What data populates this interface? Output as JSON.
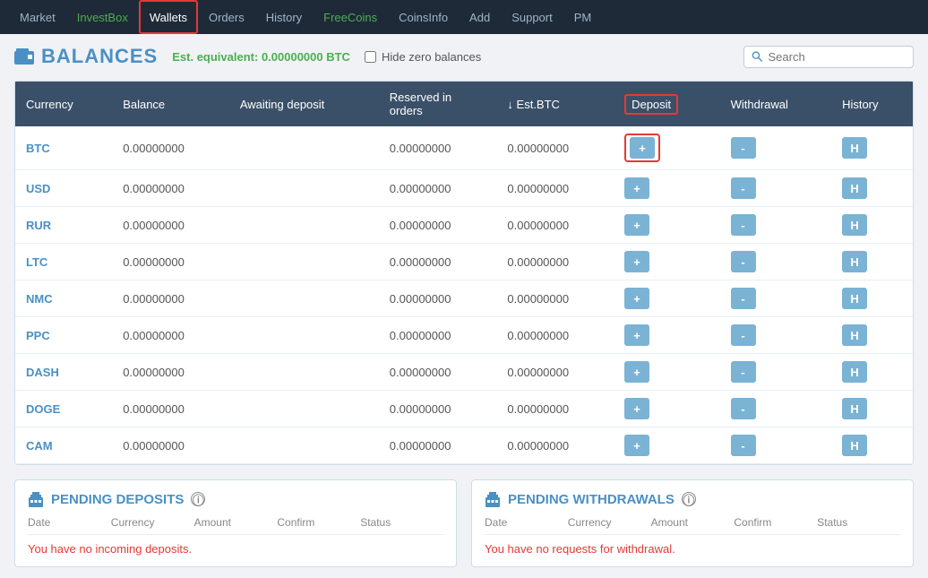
{
  "nav": {
    "items": [
      {
        "label": "Market",
        "href": "#",
        "class": ""
      },
      {
        "label": "InvestBox",
        "href": "#",
        "class": "green-nav"
      },
      {
        "label": "Wallets",
        "href": "#",
        "class": "wallets-nav"
      },
      {
        "label": "Orders",
        "href": "#",
        "class": ""
      },
      {
        "label": "History",
        "href": "#",
        "class": ""
      },
      {
        "label": "FreeCoins",
        "href": "#",
        "class": "green-nav"
      },
      {
        "label": "CoinsInfo",
        "href": "#",
        "class": ""
      },
      {
        "label": "Add",
        "href": "#",
        "class": ""
      },
      {
        "label": "Support",
        "href": "#",
        "class": ""
      },
      {
        "label": "PM",
        "href": "#",
        "class": ""
      }
    ]
  },
  "balances": {
    "title": "BALANCES",
    "est_label": "Est. equivalent:",
    "est_value": "0.00000000 BTC",
    "hide_zero_label": "Hide zero balances",
    "search_placeholder": "Search"
  },
  "table": {
    "headers": [
      {
        "label": "Currency",
        "key": "currency"
      },
      {
        "label": "Balance",
        "key": "balance"
      },
      {
        "label": "Awaiting deposit",
        "key": "awaiting"
      },
      {
        "label": "↓ Reserved in orders",
        "key": "reserved"
      },
      {
        "label": "↓ Est.BTC",
        "key": "estbtc"
      },
      {
        "label": "Deposit",
        "key": "deposit"
      },
      {
        "label": "Withdrawal",
        "key": "withdrawal"
      },
      {
        "label": "History",
        "key": "history"
      }
    ],
    "rows": [
      {
        "currency": "BTC",
        "balance": "0.00000000",
        "awaiting": "",
        "reserved": "0.00000000",
        "estbtc": "0.00000000",
        "highlight_deposit": true
      },
      {
        "currency": "USD",
        "balance": "0.00000000",
        "awaiting": "",
        "reserved": "0.00000000",
        "estbtc": "0.00000000",
        "highlight_deposit": false
      },
      {
        "currency": "RUR",
        "balance": "0.00000000",
        "awaiting": "",
        "reserved": "0.00000000",
        "estbtc": "0.00000000",
        "highlight_deposit": false
      },
      {
        "currency": "LTC",
        "balance": "0.00000000",
        "awaiting": "",
        "reserved": "0.00000000",
        "estbtc": "0.00000000",
        "highlight_deposit": false
      },
      {
        "currency": "NMC",
        "balance": "0.00000000",
        "awaiting": "",
        "reserved": "0.00000000",
        "estbtc": "0.00000000",
        "highlight_deposit": false
      },
      {
        "currency": "PPC",
        "balance": "0.00000000",
        "awaiting": "",
        "reserved": "0.00000000",
        "estbtc": "0.00000000",
        "highlight_deposit": false
      },
      {
        "currency": "DASH",
        "balance": "0.00000000",
        "awaiting": "",
        "reserved": "0.00000000",
        "estbtc": "0.00000000",
        "highlight_deposit": false
      },
      {
        "currency": "DOGE",
        "balance": "0.00000000",
        "awaiting": "",
        "reserved": "0.00000000",
        "estbtc": "0.00000000",
        "highlight_deposit": false
      },
      {
        "currency": "CAM",
        "balance": "0.00000000",
        "awaiting": "",
        "reserved": "0.00000000",
        "estbtc": "0.00000000",
        "highlight_deposit": false
      }
    ]
  },
  "pending_deposits": {
    "title": "PENDING DEPOSITS",
    "cols": [
      "Date",
      "Currency",
      "Amount",
      "Confirm",
      "Status"
    ],
    "empty_msg_pre": "You have ",
    "empty_msg_highlight": "no",
    "empty_msg_post": " incoming deposits."
  },
  "pending_withdrawals": {
    "title": "PENDING WITHDRAWALS",
    "cols": [
      "Date",
      "Currency",
      "Amount",
      "Confirm",
      "Status"
    ],
    "empty_msg_pre": "You have no requests for ",
    "empty_msg_highlight": "withdrawal",
    "empty_msg_post": "."
  }
}
